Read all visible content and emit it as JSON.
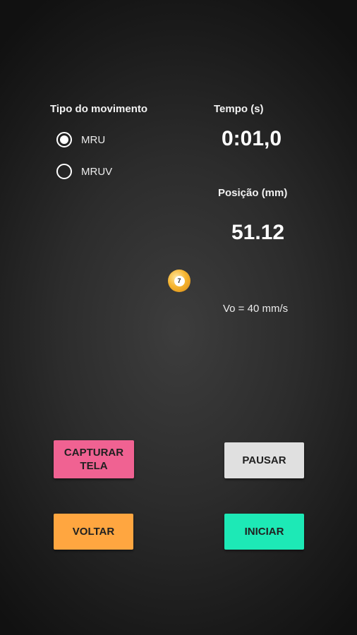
{
  "movement": {
    "title": "Tipo do movimento",
    "options": [
      {
        "label": "MRU",
        "selected": true
      },
      {
        "label": "MRUV",
        "selected": false
      }
    ]
  },
  "time": {
    "label": "Tempo (s)",
    "value": "0:01,0"
  },
  "position": {
    "label": "Posição (mm)",
    "value": "51.12"
  },
  "ball": {
    "number": "7",
    "icon": "billiard-ball-icon",
    "color": "#f6b531"
  },
  "velocity": {
    "text": "Vo = 40 mm/s"
  },
  "buttons": {
    "capture": {
      "label": "CAPTURAR\nTELA",
      "color": "#f06292"
    },
    "pause": {
      "label": "PAUSAR",
      "color": "#e0e0e0"
    },
    "back": {
      "label": "VOLTAR",
      "color": "#ffa640"
    },
    "start": {
      "label": "INICIAR",
      "color": "#1de9b6"
    }
  }
}
